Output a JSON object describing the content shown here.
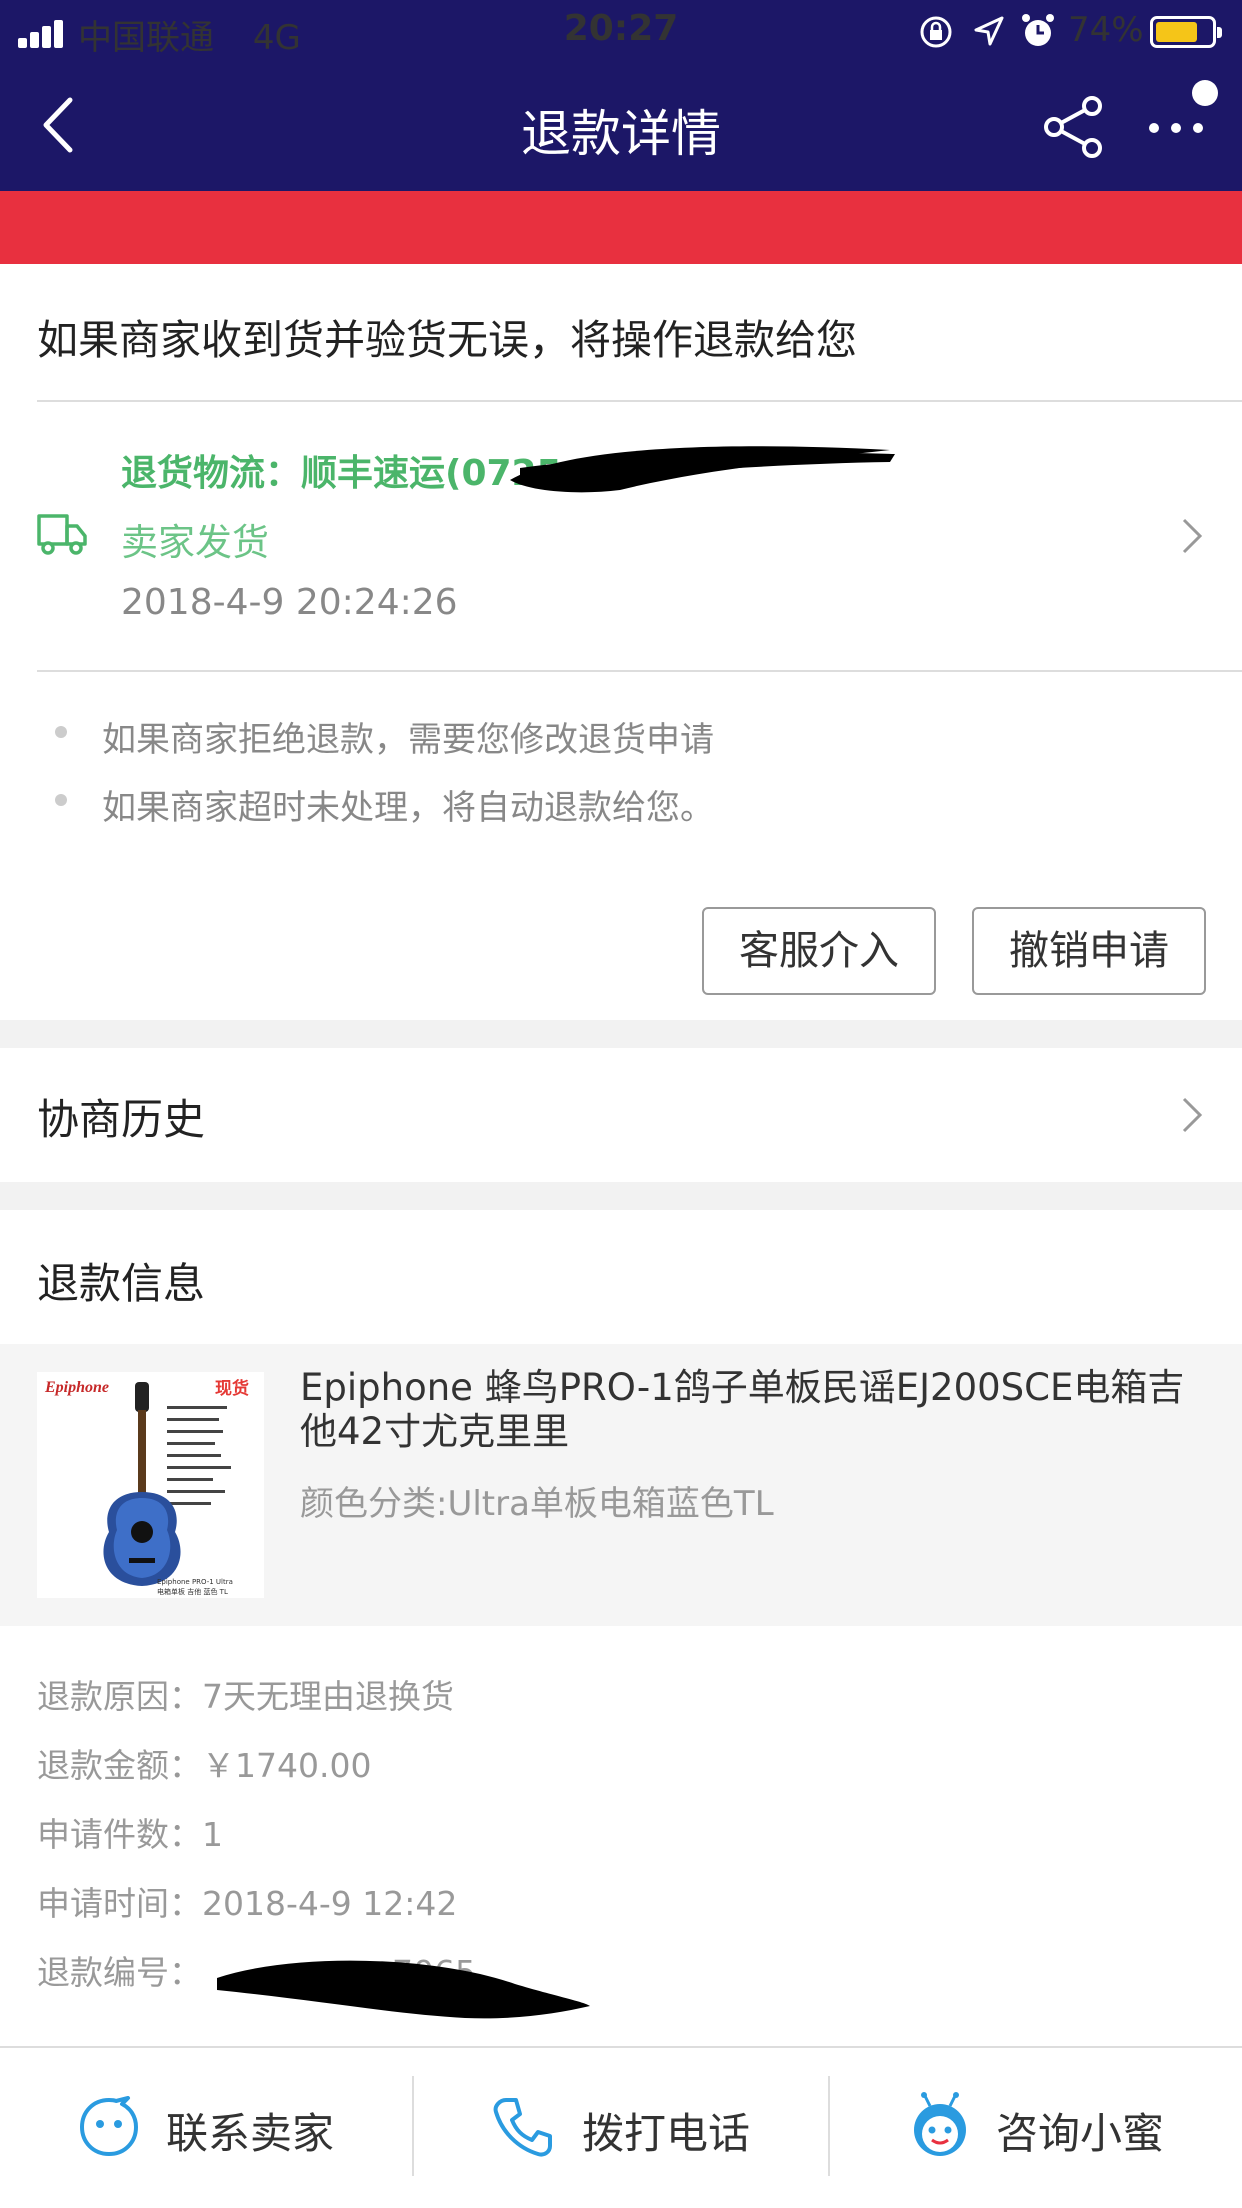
{
  "status_bar": {
    "carrier": "中国联通",
    "network": "4G",
    "time": "20:27",
    "battery_percent": "74%",
    "battery_level": 0.74,
    "icons": [
      "lock-rotation-icon",
      "location-arrow-icon",
      "alarm-icon"
    ]
  },
  "nav": {
    "title": "退款详情",
    "icons": [
      "back-icon",
      "share-icon",
      "more-icon"
    ]
  },
  "status_message": "如果商家收到货并验货无误，将操作退款给您",
  "logistics": {
    "title": "退货物流：顺丰速运(0725",
    "status": "卖家发货",
    "time": "2018-4-9 20:24:26",
    "icon": "truck-icon"
  },
  "tips": [
    "如果商家拒绝退款，需要您修改退货申请",
    "如果商家超时未处理，将自动退款给您。"
  ],
  "buttons": {
    "customer_service": "客服介入",
    "cancel_request": "撤销申请"
  },
  "history_label": "协商历史",
  "refund_info": {
    "heading": "退款信息",
    "product": {
      "title": "Epiphone 蜂鸟PRO-1鸽子单板民谣EJ200SCE电箱吉他42寸尤克里里",
      "variant": "颜色分类:Ultra单板电箱蓝色TL",
      "image_brand": "Epiphone",
      "image_tag": "现货",
      "image_caption": "Epiphone PRO-1 Ultra 电箱单板 吉他 蓝色 TL"
    },
    "rows": [
      {
        "label": "退款原因：",
        "value": "7天无理由退换货"
      },
      {
        "label": "退款金额：",
        "value": "￥1740.00"
      },
      {
        "label": "申请件数：",
        "value": "1"
      },
      {
        "label": "申请时间：",
        "value": "2018-4-9 12:42"
      },
      {
        "label": "退款编号：",
        "value": "7065"
      }
    ]
  },
  "bottom_tabs": [
    {
      "label": "联系卖家",
      "icon": "chat-face-icon"
    },
    {
      "label": "拨打电话",
      "icon": "phone-icon"
    },
    {
      "label": "咨询小蜜",
      "icon": "assistant-bee-icon"
    }
  ],
  "colors": {
    "nav_bg": "#1c1767",
    "banner_red": "#e8303f",
    "logistics_green": "#4bb56a",
    "accent_blue": "#2a9be0"
  }
}
